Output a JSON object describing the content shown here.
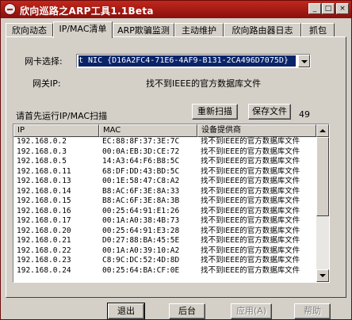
{
  "window": {
    "title": "欣向巡路之ARP工具1.1Beta"
  },
  "tabs": [
    {
      "label": "欣向动态"
    },
    {
      "label": "IP/MAC清单"
    },
    {
      "label": "ARP欺骗监测"
    },
    {
      "label": "主动维护"
    },
    {
      "label": "欣向路由器日志"
    },
    {
      "label": "抓包"
    }
  ],
  "active_tab": "IP/MAC清单",
  "nic": {
    "label": "网卡选择:",
    "selected": "t NIC   {D16A2FC4-71E6-4AF9-B131-2CA496D7075D}"
  },
  "gateway": {
    "label": "网关IP:",
    "value": "找不到IEEE的官方数据库文件"
  },
  "scan": {
    "hint": "请首先运行IP/MAC扫描",
    "rescan_label": "重新扫描",
    "save_label": "保存文件",
    "count": "49"
  },
  "table": {
    "columns": [
      "IP",
      "MAC",
      "设备提供商"
    ],
    "rows": [
      [
        "192.168.0.2",
        "EC:88:8F:37:3E:7C",
        "找不到IEEE的官方数据库文件"
      ],
      [
        "192.168.0.3",
        "00:0A:EB:3D:CE:72",
        "找不到IEEE的官方数据库文件"
      ],
      [
        "192.168.0.5",
        "14:A3:64:F6:B8:5C",
        "找不到IEEE的官方数据库文件"
      ],
      [
        "192.168.0.11",
        "68:DF:DD:43:BD:5C",
        "找不到IEEE的官方数据库文件"
      ],
      [
        "192.168.0.13",
        "00:1E:58:47:C8:A2",
        "找不到IEEE的官方数据库文件"
      ],
      [
        "192.168.0.14",
        "B8:AC:6F:3E:8A:33",
        "找不到IEEE的官方数据库文件"
      ],
      [
        "192.168.0.15",
        "B8:AC:6F:3E:8A:3B",
        "找不到IEEE的官方数据库文件"
      ],
      [
        "192.168.0.16",
        "00:25:64:91:E1:26",
        "找不到IEEE的官方数据库文件"
      ],
      [
        "192.168.0.17",
        "00:1A:A0:38:4B:73",
        "找不到IEEE的官方数据库文件"
      ],
      [
        "192.168.0.20",
        "00:25:64:91:E3:28",
        "找不到IEEE的官方数据库文件"
      ],
      [
        "192.168.0.21",
        "D0:27:88:BA:45:5E",
        "找不到IEEE的官方数据库文件"
      ],
      [
        "192.168.0.22",
        "00:1A:A0:39:10:A2",
        "找不到IEEE的官方数据库文件"
      ],
      [
        "192.168.0.23",
        "C8:9C:DC:52:4D:8D",
        "找不到IEEE的官方数据库文件"
      ],
      [
        "192.168.0.24",
        "00:25:64:BA:CF:0E",
        "找不到IEEE的官方数据库文件"
      ]
    ]
  },
  "footer": {
    "exit_label": "退出",
    "background_label": "后台",
    "apply_label": "应用(A)",
    "help_label": "帮助"
  }
}
